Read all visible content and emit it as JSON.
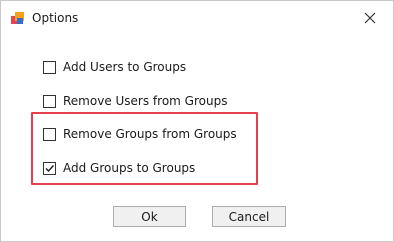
{
  "window": {
    "title": "Options",
    "app_icon": "app-logo-icon",
    "close_icon": "close-icon"
  },
  "options": [
    {
      "label": "Add Users to Groups",
      "checked": false
    },
    {
      "label": "Remove Users from Groups",
      "checked": false
    },
    {
      "label": "Remove Groups from Groups",
      "checked": false
    },
    {
      "label": "Add Groups to Groups",
      "checked": true
    }
  ],
  "buttons": {
    "ok_label": "Ok",
    "cancel_label": "Cancel"
  },
  "colors": {
    "highlight": "#e5404b",
    "button_bg": "#f0f0f0"
  }
}
